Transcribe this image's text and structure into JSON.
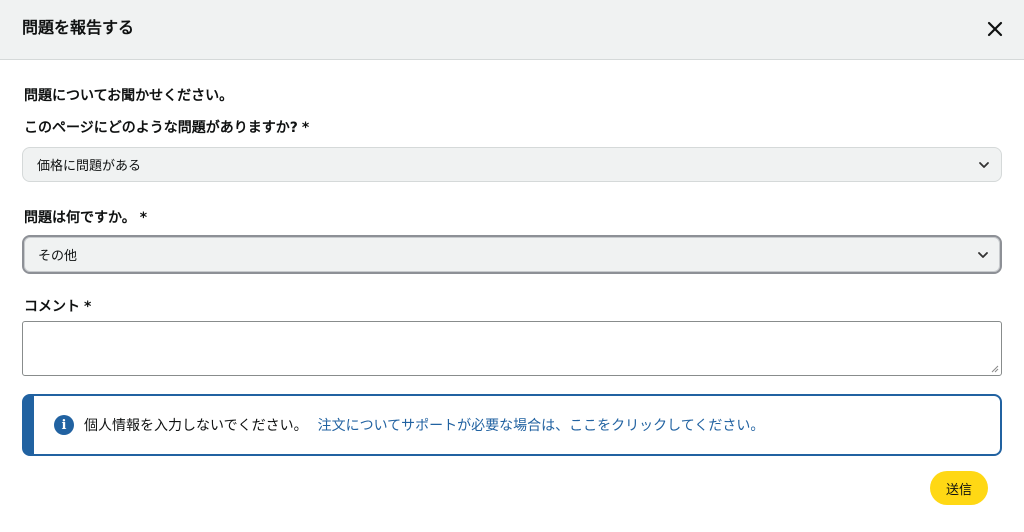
{
  "dialog": {
    "title": "問題を報告する",
    "close_icon": "close-icon"
  },
  "form": {
    "intro": "問題についてお聞かせください。",
    "page_issue": {
      "label": "このページにどのような問題がありますか?",
      "required_mark": "*",
      "selected": "価格に問題がある"
    },
    "problem": {
      "label": "問題は何ですか。",
      "required_mark": "*",
      "selected": "その他"
    },
    "comment": {
      "label": "コメント",
      "required_mark": "*",
      "value": ""
    },
    "notice": {
      "icon": "info-icon",
      "text": "個人情報を入力しないでください。",
      "link": "注文についてサポートが必要な場合は、ここをクリックしてください。"
    },
    "submit_label": "送信"
  },
  "colors": {
    "header_bg": "#f0f2f2",
    "link": "#2162a1",
    "button": "#ffd814"
  }
}
